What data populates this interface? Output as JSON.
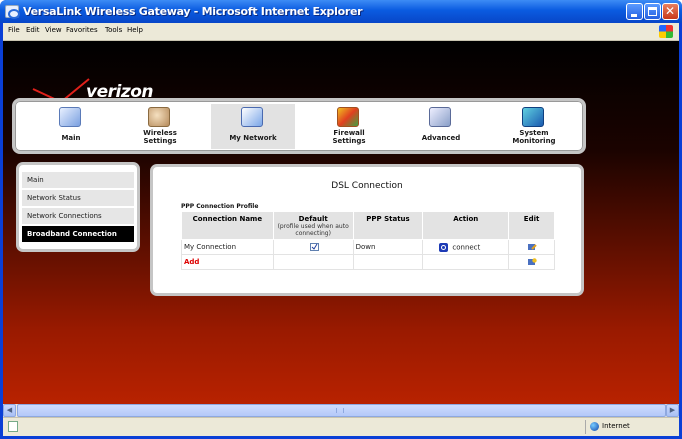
{
  "window": {
    "title": "VersaLink Wireless Gateway - Microsoft Internet Explorer"
  },
  "menubar": {
    "items": [
      "File",
      "Edit",
      "View",
      "Favorites",
      "Tools",
      "Help"
    ]
  },
  "brand": {
    "logo_text": "verizon"
  },
  "nav": {
    "items": [
      {
        "label": "Main",
        "icon": "main-page-icon"
      },
      {
        "label": "Wireless\nSettings",
        "icon": "wireless-icon"
      },
      {
        "label": "My Network",
        "icon": "network-icon",
        "active": true
      },
      {
        "label": "Firewall\nSettings",
        "icon": "firewall-icon"
      },
      {
        "label": "Advanced",
        "icon": "advanced-icon"
      },
      {
        "label": "System\nMonitoring",
        "icon": "monitor-icon"
      }
    ]
  },
  "sidebar": {
    "items": [
      {
        "label": "Main"
      },
      {
        "label": "Network Status"
      },
      {
        "label": "Network Connections"
      },
      {
        "label": "Broadband Connection",
        "active": true
      }
    ]
  },
  "panel": {
    "title": "DSL Connection",
    "profile_label": "PPP Connection Profile",
    "table": {
      "headers": {
        "name": "Connection Name",
        "default": "Default",
        "default_sub": "(profile used when auto connecting)",
        "status": "PPP Status",
        "action": "Action",
        "edit": "Edit"
      },
      "rows": [
        {
          "name": "My Connection",
          "default_icon": "checkbox-icon",
          "status": "Down",
          "action": "connect",
          "action_icon": "connect-icon",
          "edit_icon": "edit-icon"
        }
      ],
      "add_label": "Add"
    }
  },
  "statusbar": {
    "zone": "Internet"
  },
  "colors": {
    "accent_red": "#d00000",
    "active_item_bg": "#000000",
    "titlebar": "#0a5be0"
  }
}
